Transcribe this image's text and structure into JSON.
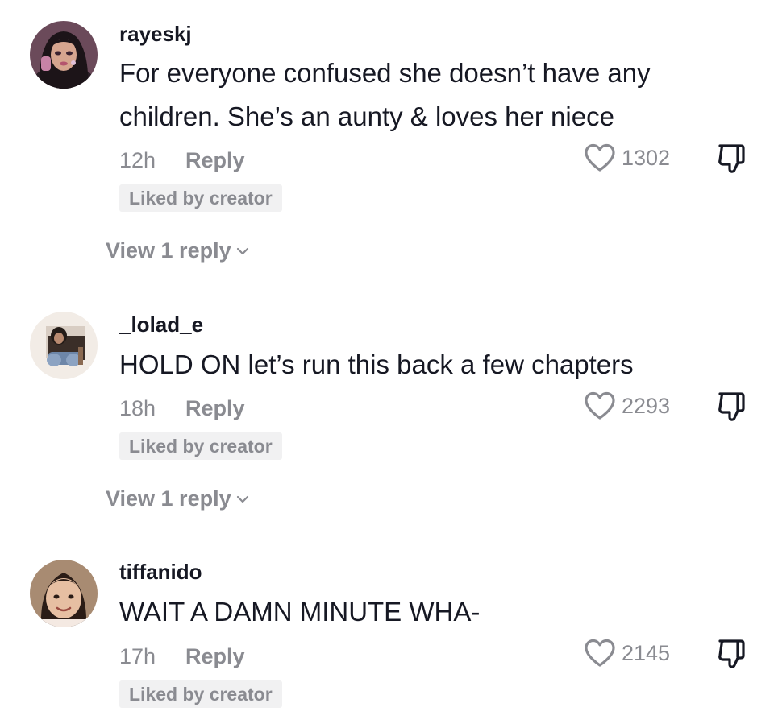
{
  "comments": [
    {
      "username": "rayeskj",
      "text": "For everyone confused she doesn’t have any children. She’s an aunty & loves her niece",
      "time": "12h",
      "reply_label": "Reply",
      "likes": "1302",
      "badge": "Liked by creator",
      "view_replies": "View 1 reply"
    },
    {
      "username": "_lolad_e",
      "text": "HOLD ON let’s run this back a few chapters",
      "time": "18h",
      "reply_label": "Reply",
      "likes": "2293",
      "badge": "Liked by creator",
      "view_replies": "View 1 reply"
    },
    {
      "username": "tiffanido_",
      "text": "WAIT A DAMN MINUTE WHA-",
      "time": "17h",
      "reply_label": "Reply",
      "likes": "2145",
      "badge": "Liked by creator"
    }
  ],
  "icons": {
    "like": "heart-outline-icon",
    "dislike": "thumbs-down-icon",
    "expand": "chevron-down-icon"
  },
  "colors": {
    "text": "#161823",
    "muted": "#8a8b91",
    "badge_bg": "#f1f1f2"
  }
}
